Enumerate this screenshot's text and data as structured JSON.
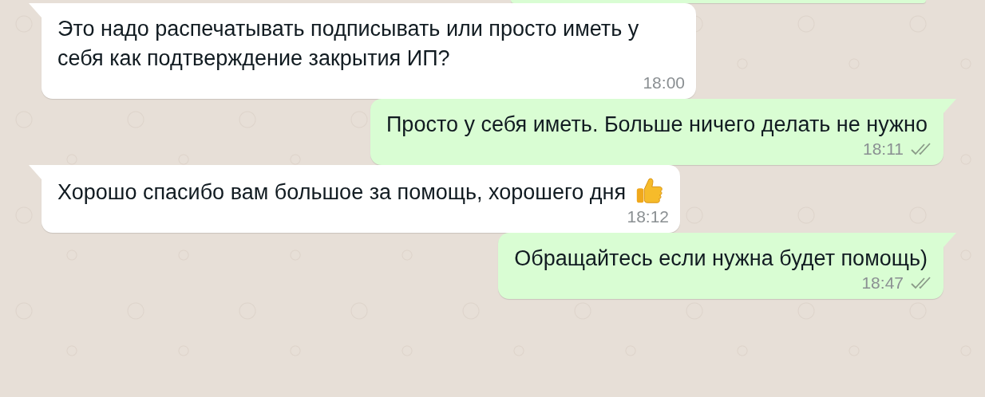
{
  "messages": [
    {
      "kind": "fragment",
      "outgoing": true
    },
    {
      "kind": "text",
      "outgoing": false,
      "text": "Это надо распечатывать подписывать или просто иметь у себя как подтверждение закрытия ИП?",
      "time": "18:00"
    },
    {
      "kind": "text",
      "outgoing": true,
      "text": "Просто у себя иметь. Больше ничего делать не нужно",
      "time": "18:11",
      "read": false
    },
    {
      "kind": "text_emoji",
      "outgoing": false,
      "text": "Хорошо спасибо вам большое за помощь, хорошего дня",
      "time": "18:12"
    },
    {
      "kind": "text",
      "outgoing": true,
      "text": "Обращайтесь если нужна будет помощь)",
      "time": "18:47",
      "read": false
    }
  ]
}
